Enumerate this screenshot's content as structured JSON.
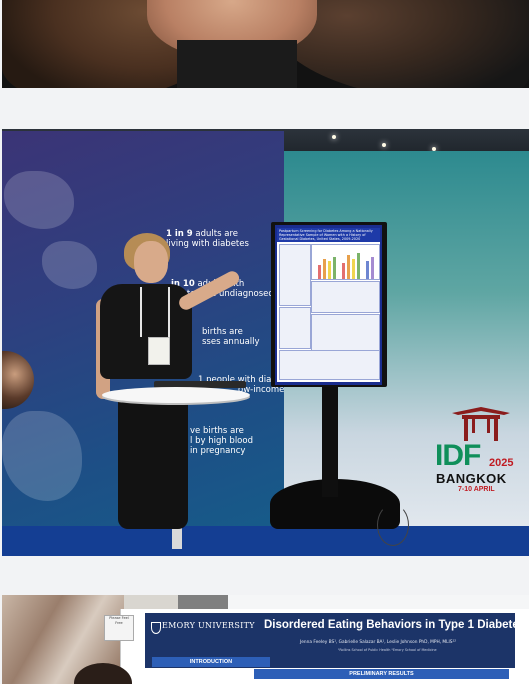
{
  "booth": {
    "stats": [
      {
        "number": "1 in 9",
        "text_a": "adults are",
        "text_b": "living with diabetes"
      },
      {
        "number": "in 10",
        "text_a": "adults with",
        "text_b": "abetes are undiagnosed"
      },
      {
        "text_a": "births are",
        "text_b": "sses annually"
      },
      {
        "text_a": "1 people with diabetes",
        "text_b": "ow-income"
      },
      {
        "text_a": "ve births are",
        "text_b": "l by high blood",
        "text_c": "in pregnancy"
      }
    ],
    "poster_title": "Postpartum Screening for Diabetes Among a Nationally Representative Sample of Women with a History of Gestational Diabetes, United States, 2009-2020",
    "logo": {
      "name": "IDF",
      "year": "2025",
      "city": "BANGKOK",
      "dates": "7-10 APRIL",
      "color_green": "#0f8f5a",
      "color_red": "#c01b22"
    }
  },
  "emory_poster": {
    "university": "EMORY UNIVERSITY",
    "title": "Disordered Eating Behaviors in Type 1 Diabetes",
    "authors": "Jenna Feeley BS¹, Gabrielle Salazar BA¹, Leslie Johnson PhD, MPH, MLIS¹²",
    "affiliation": "¹Rollins School of Public Health  ²Emory School of Medicine",
    "section_intro": "INTRODUCTION",
    "section_results": "PRELIMINARY RESULTS",
    "sticker_text": "Please\nFeel Free"
  }
}
